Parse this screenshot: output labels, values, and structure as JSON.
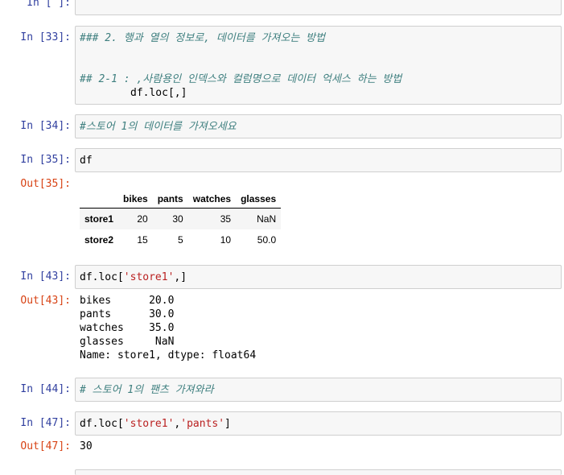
{
  "cells": [
    {
      "prompt": "In [ ]:"
    },
    {
      "prompt": "In [33]:",
      "lines": [
        "### 2. 행과 열의 정보로, 데이터를 가져오는 방법",
        "## 2-1 : ,사람용인 인덱스와 컬럼명으로 데이터 억세스 하는 방법",
        "df.loc[,]"
      ]
    },
    {
      "prompt": "In [34]:",
      "lines": [
        "#스토어 1의 데이터를 가져오세요"
      ]
    },
    {
      "prompt": "In [35]:",
      "lines": [
        "df"
      ],
      "out_prompt": "Out[35]:"
    },
    {
      "prompt": "In [43]:",
      "code": {
        "pre": "df.loc[",
        "str": "'store1'",
        "post": ",]"
      },
      "out_prompt": "Out[43]:",
      "output": [
        "bikes      20.0",
        "pants      30.0",
        "watches    35.0",
        "glasses     NaN",
        "Name: store1, dtype: float64"
      ]
    },
    {
      "prompt": "In [44]:",
      "lines": [
        "# 스토어 1의 팬츠 가져와라"
      ]
    },
    {
      "prompt": "In [47]:",
      "code": {
        "pre": "df.loc[",
        "str": "'store1'",
        "mid": ",",
        "str2": "'pants'",
        "post": "]"
      },
      "out_prompt": "Out[47]:",
      "output": [
        "30"
      ]
    }
  ],
  "dataframe": {
    "columns": [
      "",
      "bikes",
      "pants",
      "watches",
      "glasses"
    ],
    "rows": [
      [
        "store1",
        "20",
        "30",
        "35",
        "NaN"
      ],
      [
        "store2",
        "15",
        "5",
        "10",
        "50.0"
      ]
    ]
  }
}
